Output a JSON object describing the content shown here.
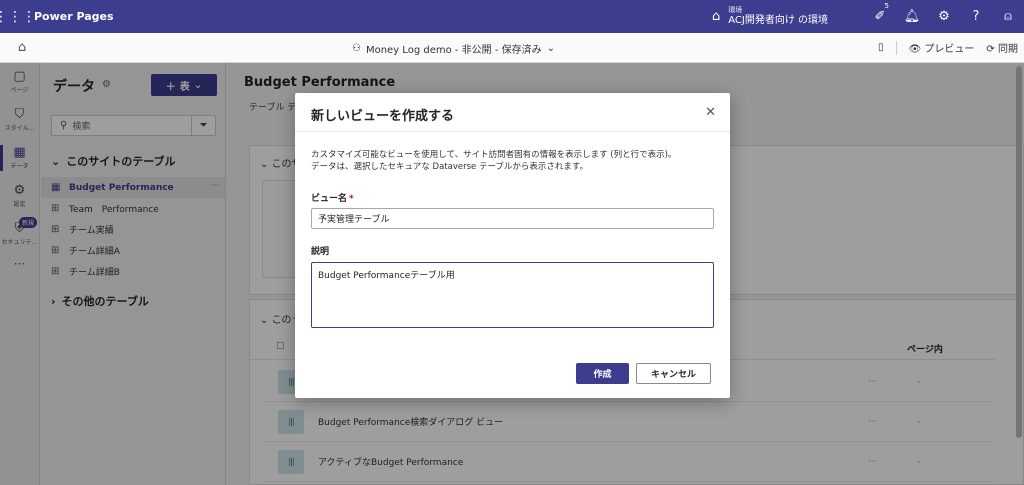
{
  "topbar": {
    "app_name": "Power Pages",
    "env_label": "環境",
    "env_name": "ACJ開発者向け の環境",
    "badge_count": "5"
  },
  "subbar": {
    "site_title": "Money Log demo - 非公開 - 保存済み",
    "preview": "プレビュー",
    "sync": "同期"
  },
  "rail": {
    "items": [
      {
        "label": "ページ",
        "icon": "page-icon"
      },
      {
        "label": "スタイル...",
        "icon": "style-icon"
      },
      {
        "label": "データ",
        "icon": "table-icon"
      },
      {
        "label": "設定",
        "icon": "settings-icon"
      },
      {
        "label": "セキュリテ...",
        "icon": "shield-icon"
      }
    ],
    "new_badge": "新規"
  },
  "panel": {
    "title": "データ",
    "add_label": "表",
    "search_placeholder": "検索",
    "section_site": "このサイトのテーブル",
    "section_other": "その他のテーブル",
    "tables": [
      {
        "name": "Budget Performance"
      },
      {
        "name": "Team　Performance"
      },
      {
        "name": "チーム実績"
      },
      {
        "name": "チーム詳細A"
      },
      {
        "name": "チーム詳細B"
      }
    ]
  },
  "main": {
    "title": "Budget Performance",
    "tabs_text": "テーブル デ",
    "card1_head": "このサ",
    "card2_head": "このう",
    "col_page": "ページ内",
    "views": [
      {
        "name": "",
        "page": "-"
      },
      {
        "name": "Budget Performance検索ダイアログ ビュー",
        "page": "-"
      },
      {
        "name": "アクティブなBudget Performance",
        "page": "-"
      }
    ]
  },
  "dialog": {
    "title": "新しいビューを作成する",
    "description_line1": "カスタマイズ可能なビューを使用して、サイト訪問者固有の情報を表示します (列と行で表示)。",
    "description_line2": "データは、選択したセキュアな Dataverse テーブルから表示されます。",
    "name_label": "ビュー名",
    "name_value": "予実管理テーブル",
    "desc_label": "説明",
    "desc_value": "Budget Performanceテーブル用",
    "create_label": "作成",
    "cancel_label": "キャンセル"
  },
  "colors": {
    "brand": "#3d3d8f",
    "view_icon_bg": "#cfe6ea"
  }
}
